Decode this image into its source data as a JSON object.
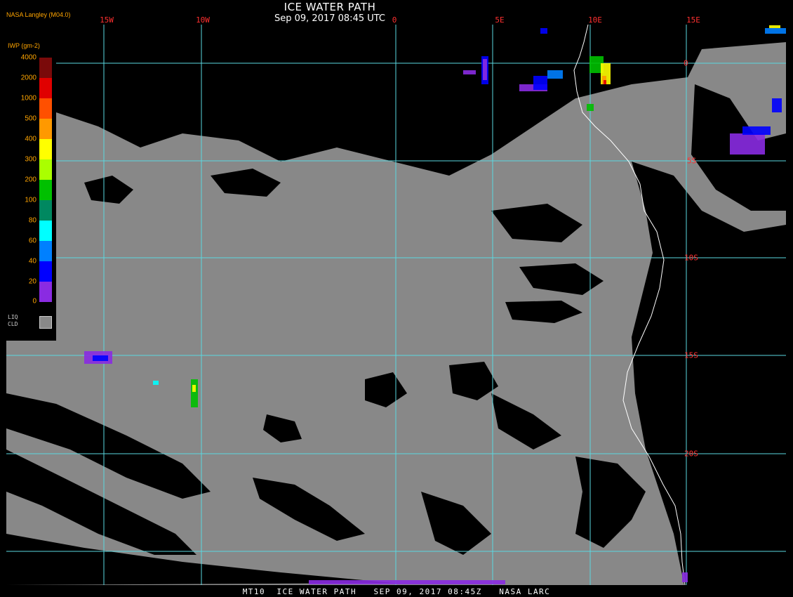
{
  "header": {
    "title": "ICE WATER PATH",
    "datetime": "Sep 09, 2017 08:45 UTC",
    "credit": "NASA Langley (M04.0)"
  },
  "map": {
    "clear_color": "#000000",
    "liquid_cloud_color": "#888888",
    "grid_color": "#5ad8e0",
    "coast_color": "#ffffff",
    "label_color": "#ff3030",
    "lon_labels": [
      "15W",
      "10W",
      "0",
      "5E",
      "10E",
      "15E"
    ],
    "lat_labels": [
      "0",
      "5S",
      "10S",
      "15S",
      "20S"
    ]
  },
  "legend": {
    "title": "IWP (gm-2)",
    "ticks": [
      "4000",
      "2000",
      "1000",
      "500",
      "400",
      "300",
      "200",
      "100",
      "80",
      "60",
      "40",
      "20",
      "0"
    ],
    "colors": [
      "#7a0a0a",
      "#e00000",
      "#ff5000",
      "#ff9900",
      "#ffff00",
      "#aaff00",
      "#00c000",
      "#008860",
      "#00ffff",
      "#0080ff",
      "#0000ff",
      "#8a2be2"
    ],
    "liq_label": "LIQ\nCLD"
  },
  "footer": "MT10  ICE WATER PATH   SEP 09, 2017 08:45Z   NASA LARC"
}
